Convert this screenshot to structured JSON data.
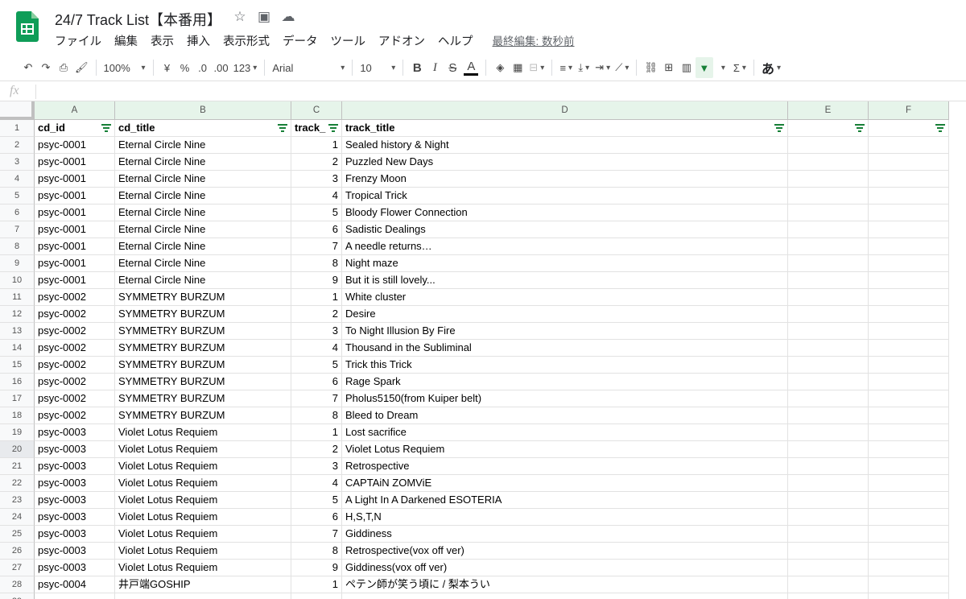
{
  "app": {
    "title": "24/7 Track List【本番用】",
    "menu": [
      "ファイル",
      "編集",
      "表示",
      "挿入",
      "表示形式",
      "データ",
      "ツール",
      "アドオン",
      "ヘルプ"
    ],
    "last_edit": "最終編集: 数秒前"
  },
  "toolbar": {
    "zoom": "100%",
    "currency": "¥",
    "percent": "%",
    "dec_decrease": ".0",
    "dec_increase": ".00",
    "format_more": "123",
    "font": "Arial",
    "font_size": "10",
    "bold": "B",
    "italic": "I",
    "strike": "S",
    "text_color": "A",
    "input_tool": "あ"
  },
  "formula": {
    "label": "fx"
  },
  "columns": [
    "A",
    "B",
    "C",
    "D",
    "E",
    "F"
  ],
  "sheet": {
    "header": [
      "cd_id",
      "cd_title",
      "track_",
      "track_title",
      "",
      ""
    ],
    "rows": [
      [
        "psyc-0001",
        "Eternal Circle Nine",
        "1",
        "Sealed history & Night"
      ],
      [
        "psyc-0001",
        "Eternal Circle Nine",
        "2",
        "Puzzled New Days"
      ],
      [
        "psyc-0001",
        "Eternal Circle Nine",
        "3",
        "Frenzy Moon"
      ],
      [
        "psyc-0001",
        "Eternal Circle Nine",
        "4",
        "Tropical Trick"
      ],
      [
        "psyc-0001",
        "Eternal Circle Nine",
        "5",
        "Bloody Flower Connection"
      ],
      [
        "psyc-0001",
        "Eternal Circle Nine",
        "6",
        "Sadistic Dealings"
      ],
      [
        "psyc-0001",
        "Eternal Circle Nine",
        "7",
        "A needle returns…"
      ],
      [
        "psyc-0001",
        "Eternal Circle Nine",
        "8",
        "Night maze"
      ],
      [
        "psyc-0001",
        "Eternal Circle Nine",
        "9",
        "But it is still lovely..."
      ],
      [
        "psyc-0002",
        "SYMMETRY BURZUM",
        "1",
        "White cluster"
      ],
      [
        "psyc-0002",
        "SYMMETRY BURZUM",
        "2",
        "Desire"
      ],
      [
        "psyc-0002",
        "SYMMETRY BURZUM",
        "3",
        "To Night Illusion By Fire"
      ],
      [
        "psyc-0002",
        "SYMMETRY BURZUM",
        "4",
        "Thousand in the Subliminal"
      ],
      [
        "psyc-0002",
        "SYMMETRY BURZUM",
        "5",
        "Trick this Trick"
      ],
      [
        "psyc-0002",
        "SYMMETRY BURZUM",
        "6",
        "Rage Spark"
      ],
      [
        "psyc-0002",
        "SYMMETRY BURZUM",
        "7",
        "Pholus5150(from Kuiper belt)"
      ],
      [
        "psyc-0002",
        "SYMMETRY BURZUM",
        "8",
        "Bleed to Dream"
      ],
      [
        "psyc-0003",
        "Violet Lotus Requiem",
        "1",
        "Lost sacrifice"
      ],
      [
        "psyc-0003",
        "Violet Lotus Requiem",
        "2",
        "Violet Lotus Requiem"
      ],
      [
        "psyc-0003",
        "Violet Lotus Requiem",
        "3",
        "Retrospective"
      ],
      [
        "psyc-0003",
        "Violet Lotus Requiem",
        "4",
        "CAPTAiN ZOMViE"
      ],
      [
        "psyc-0003",
        "Violet Lotus Requiem",
        "5",
        "A Light In A Darkened ESOTERIA"
      ],
      [
        "psyc-0003",
        "Violet Lotus Requiem",
        "6",
        "H,S,T,N"
      ],
      [
        "psyc-0003",
        "Violet Lotus Requiem",
        "7",
        "Giddiness"
      ],
      [
        "psyc-0003",
        "Violet Lotus Requiem",
        "8",
        "Retrospective(vox off ver)"
      ],
      [
        "psyc-0003",
        "Violet Lotus Requiem",
        "9",
        "Giddiness(vox off ver)"
      ],
      [
        "psyc-0004",
        "井戸端GOSHIP",
        "1",
        "ペテン師が笑う頃に / 梨本うい"
      ]
    ]
  },
  "colors": {
    "brand": "#0f9d58",
    "filter": "#188038",
    "header_bg": "#e6f4ea"
  }
}
